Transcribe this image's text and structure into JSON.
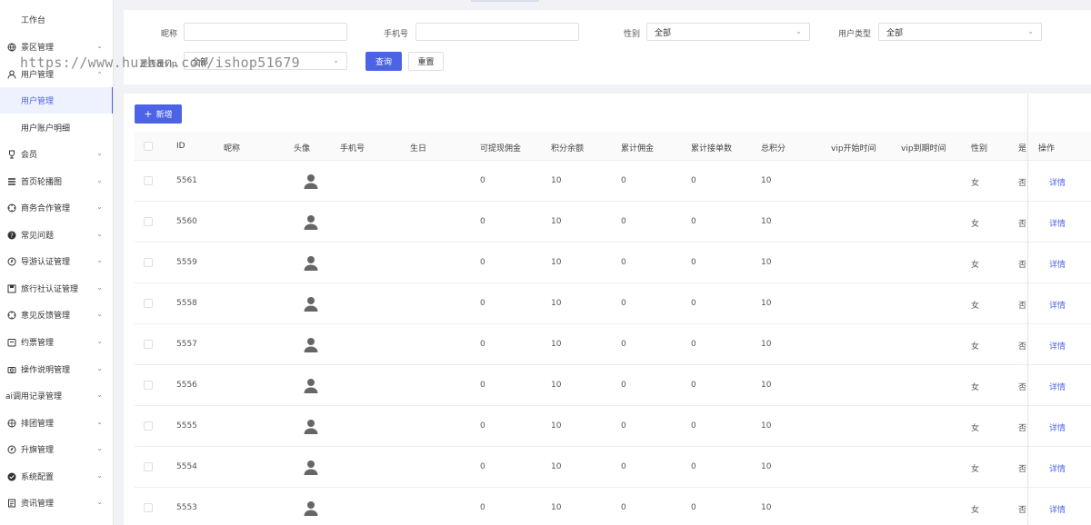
{
  "sidebar": {
    "items": [
      {
        "label": "工作台",
        "icon": "none",
        "type": "top"
      },
      {
        "label": "景区管理",
        "icon": "globe-icon",
        "type": "collapsible"
      },
      {
        "label": "用户管理",
        "icon": "user-icon",
        "type": "expanded"
      },
      {
        "label": "用户管理",
        "icon": "none",
        "type": "sub-active"
      },
      {
        "label": "用户账户明细",
        "icon": "none",
        "type": "sub"
      },
      {
        "label": "会员",
        "icon": "trophy-icon",
        "type": "collapsible"
      },
      {
        "label": "首页轮播图",
        "icon": "list-icon",
        "type": "collapsible"
      },
      {
        "label": "商务合作管理",
        "icon": "target-icon",
        "type": "collapsible"
      },
      {
        "label": "常见问题",
        "icon": "question-icon",
        "type": "collapsible"
      },
      {
        "label": "导游认证管理",
        "icon": "compass-icon",
        "type": "collapsible"
      },
      {
        "label": "旅行社认证管理",
        "icon": "save-icon",
        "type": "collapsible"
      },
      {
        "label": "意见反馈管理",
        "icon": "target-icon",
        "type": "collapsible"
      },
      {
        "label": "约票管理",
        "icon": "calendar-icon",
        "type": "collapsible"
      },
      {
        "label": "操作说明管理",
        "icon": "camera-icon",
        "type": "collapsible"
      },
      {
        "label": "ai调用记录管理",
        "icon": "none",
        "type": "collapsible-noicon"
      },
      {
        "label": "排团管理",
        "icon": "basketball-icon",
        "type": "collapsible"
      },
      {
        "label": "升旗管理",
        "icon": "compass-icon",
        "type": "collapsible"
      },
      {
        "label": "系统配置",
        "icon": "check-circle-icon",
        "type": "collapsible"
      },
      {
        "label": "资讯管理",
        "icon": "document-icon",
        "type": "collapsible"
      }
    ]
  },
  "watermark": "https://www.huzhan.com/ishop51679",
  "filters": {
    "nickname_label": "昵称",
    "nickname_value": "",
    "phone_label": "手机号",
    "phone_value": "",
    "gender_label": "性别",
    "gender_value": "全部",
    "usertype_label": "用户类型",
    "usertype_value": "全部",
    "vip_label": "是否是vip",
    "vip_value": "全部",
    "query_label": "查询",
    "reset_label": "重置"
  },
  "table": {
    "add_label": "新增",
    "columns": [
      "ID",
      "昵称",
      "头像",
      "手机号",
      "生日",
      "可提现佣金",
      "积分余额",
      "累计佣金",
      "累计接单数",
      "总积分",
      "vip开始时间",
      "vip到期时间",
      "性别",
      "是",
      "操作"
    ],
    "rows": [
      {
        "id": "5561",
        "nickname": "",
        "phone": "",
        "birthday": "",
        "withdrawable": "0",
        "points": "10",
        "commission": "0",
        "orders": "0",
        "total_points": "10",
        "vip_start": "",
        "vip_end": "",
        "gender": "女",
        "vip": "否",
        "action": "详情"
      },
      {
        "id": "5560",
        "nickname": "",
        "phone": "",
        "birthday": "",
        "withdrawable": "0",
        "points": "10",
        "commission": "0",
        "orders": "0",
        "total_points": "10",
        "vip_start": "",
        "vip_end": "",
        "gender": "女",
        "vip": "否",
        "action": "详情"
      },
      {
        "id": "5559",
        "nickname": "",
        "phone": "",
        "birthday": "",
        "withdrawable": "0",
        "points": "10",
        "commission": "0",
        "orders": "0",
        "total_points": "10",
        "vip_start": "",
        "vip_end": "",
        "gender": "女",
        "vip": "否",
        "action": "详情"
      },
      {
        "id": "5558",
        "nickname": "",
        "phone": "",
        "birthday": "",
        "withdrawable": "0",
        "points": "10",
        "commission": "0",
        "orders": "0",
        "total_points": "10",
        "vip_start": "",
        "vip_end": "",
        "gender": "女",
        "vip": "否",
        "action": "详情"
      },
      {
        "id": "5557",
        "nickname": "",
        "phone": "",
        "birthday": "",
        "withdrawable": "0",
        "points": "10",
        "commission": "0",
        "orders": "0",
        "total_points": "10",
        "vip_start": "",
        "vip_end": "",
        "gender": "女",
        "vip": "否",
        "action": "详情"
      },
      {
        "id": "5556",
        "nickname": "",
        "phone": "",
        "birthday": "",
        "withdrawable": "0",
        "points": "10",
        "commission": "0",
        "orders": "0",
        "total_points": "10",
        "vip_start": "",
        "vip_end": "",
        "gender": "女",
        "vip": "否",
        "action": "详情"
      },
      {
        "id": "5555",
        "nickname": "",
        "phone": "",
        "birthday": "",
        "withdrawable": "0",
        "points": "10",
        "commission": "0",
        "orders": "0",
        "total_points": "10",
        "vip_start": "",
        "vip_end": "",
        "gender": "女",
        "vip": "否",
        "action": "详情"
      },
      {
        "id": "5554",
        "nickname": "",
        "phone": "",
        "birthday": "",
        "withdrawable": "0",
        "points": "10",
        "commission": "0",
        "orders": "0",
        "total_points": "10",
        "vip_start": "",
        "vip_end": "",
        "gender": "女",
        "vip": "否",
        "action": "详情"
      },
      {
        "id": "5553",
        "nickname": "",
        "phone": "",
        "birthday": "",
        "withdrawable": "0",
        "points": "10",
        "commission": "0",
        "orders": "0",
        "total_points": "10",
        "vip_start": "",
        "vip_end": "",
        "gender": "女",
        "vip": "否",
        "action": "详情"
      }
    ]
  },
  "colors": {
    "primary": "#4c63e6",
    "active_bg": "#eef2ff",
    "page_bg": "#f0f2f5"
  }
}
